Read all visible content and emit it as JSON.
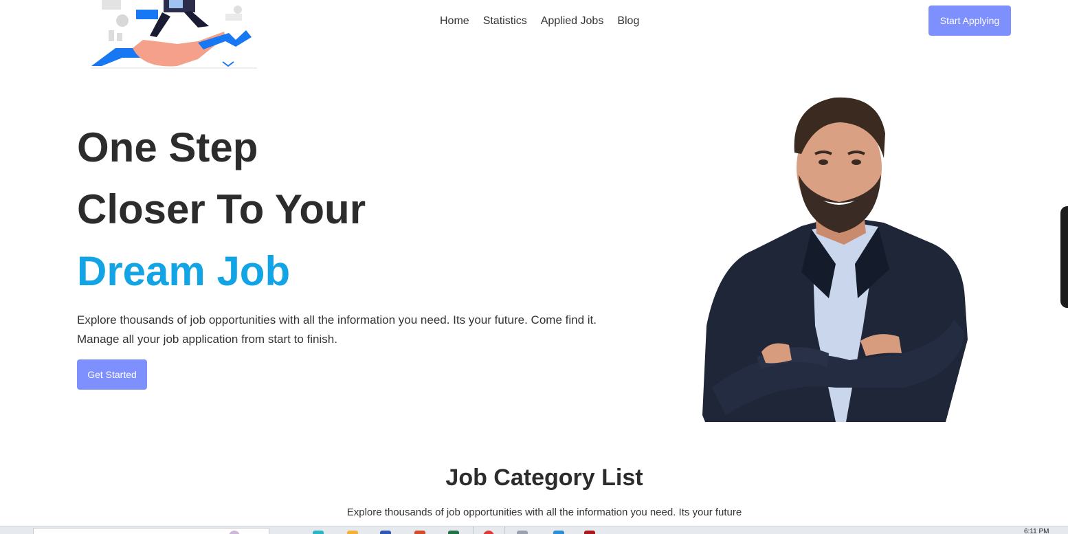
{
  "nav": {
    "items": [
      "Home",
      "Statistics",
      "Applied Jobs",
      "Blog"
    ],
    "cta_label": "Start Applying"
  },
  "hero": {
    "title_line1": "One Step",
    "title_line2": "Closer To Your",
    "title_line3": "Dream Job",
    "desc_line1": "Explore thousands of job opportunities with all the information you need. Its your future. Come find it.",
    "desc_line2": "Manage all your job application from start to finish.",
    "button_label": "Get Started"
  },
  "category_section": {
    "title": "Job Category List",
    "description": "Explore thousands of job opportunities with all the information you need. Its your future"
  },
  "taskbar": {
    "clock": "6:11 PM"
  },
  "colors": {
    "accent": "#7e90fe",
    "title_accent": "#12a4e5",
    "text": "#2c2c2c"
  },
  "icons": [
    "career-illustration-logo",
    "businessman-photo",
    "taskbar-app-icons"
  ]
}
